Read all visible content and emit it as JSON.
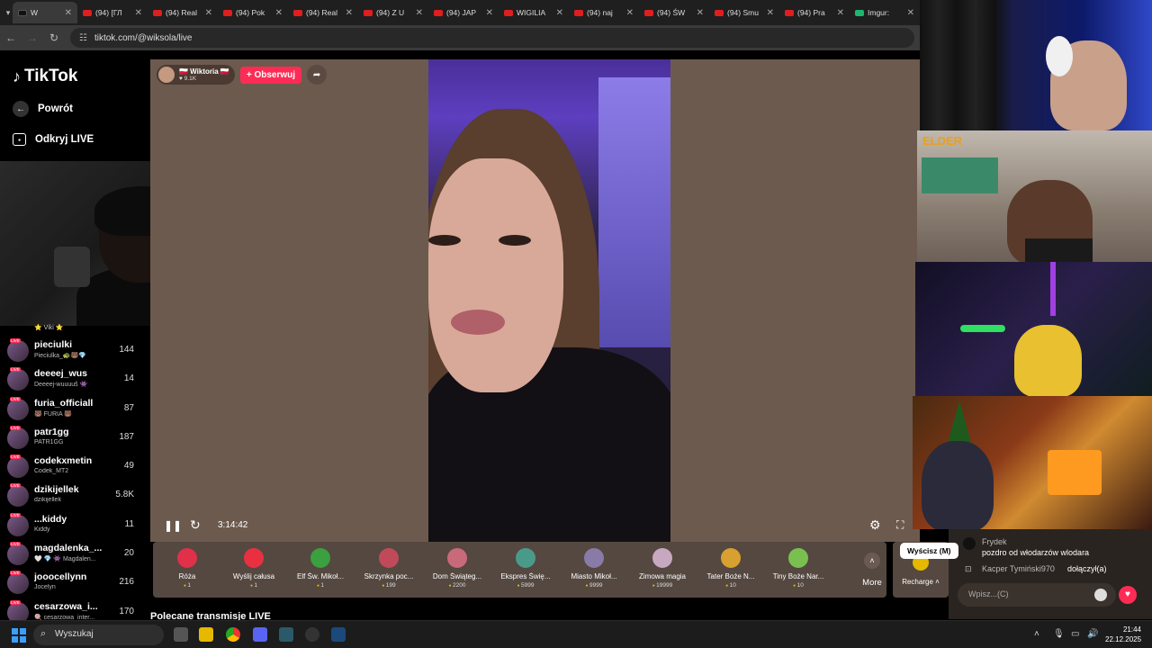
{
  "browser": {
    "url": "tiktok.com/@wiksola/live",
    "tabs": [
      {
        "title": "W",
        "type": "tiktok",
        "active": true
      },
      {
        "title": "(94) [ГЛ",
        "type": "yt"
      },
      {
        "title": "(94) Real",
        "type": "yt"
      },
      {
        "title": "(94) Pok",
        "type": "yt"
      },
      {
        "title": "(94) Real",
        "type": "yt"
      },
      {
        "title": "(94) Z U",
        "type": "yt"
      },
      {
        "title": "(94) JAP",
        "type": "yt"
      },
      {
        "title": "WIGILIA",
        "type": "yt"
      },
      {
        "title": "(94) naj",
        "type": "yt"
      },
      {
        "title": "(94) ŚW",
        "type": "yt"
      },
      {
        "title": "(94) Smu",
        "type": "yt"
      },
      {
        "title": "(94) Pra",
        "type": "yt"
      },
      {
        "title": "Imgur:",
        "type": "im"
      }
    ]
  },
  "sidebar": {
    "logo": "TikTok",
    "nav": [
      {
        "label": "Powrót",
        "icon": "back-arrow-icon"
      },
      {
        "label": "Odkryj LIVE",
        "icon": "live-tv-icon"
      }
    ],
    "partial_sub": "⭐ Viki ⭐",
    "accounts": [
      {
        "name": "pieciulki",
        "sub": "Pieciulka_🐢🐻💎",
        "count": "144"
      },
      {
        "name": "deeeej_wus",
        "sub": "Deeeej-wuuuuš 👾",
        "count": "14"
      },
      {
        "name": "furia_officiall",
        "sub": "🐻 FURIA 🐻",
        "count": "87"
      },
      {
        "name": "patr1gg",
        "sub": "PATR1GG",
        "count": "187"
      },
      {
        "name": "codekxmetin",
        "sub": "Codek_MT2",
        "count": "49"
      },
      {
        "name": "dzikijellek",
        "sub": "dzikijellek",
        "count": "5.8K"
      },
      {
        "name": "...kiddy",
        "sub": "Kiddy",
        "count": "11"
      },
      {
        "name": "magdalenka_...",
        "sub": "🤍 💎 👾 Magdalen...",
        "count": "20"
      },
      {
        "name": "jooocellynn",
        "sub": "Jocelyn",
        "count": "216"
      },
      {
        "name": "cesarzowa_i...",
        "sub": "🍭 cesarzowa_inter...",
        "count": "170"
      }
    ]
  },
  "stream": {
    "host_name": "🇵🇱 Wiktoria 🇵🇱",
    "host_likes": "♥ 9.1K",
    "follow_label": "+ Obserwuj",
    "timer": "3:14:42",
    "mute_tooltip": "Wyścisz (M)"
  },
  "gifts": [
    {
      "name": "Róża",
      "price": "1",
      "color": "#e0304a"
    },
    {
      "name": "Wyślij całusa",
      "price": "1",
      "color": "#e83040"
    },
    {
      "name": "Elf Św. Mikoł...",
      "price": "1",
      "color": "#3aa040"
    },
    {
      "name": "Skrzynka poc...",
      "price": "199",
      "color": "#c04a5a"
    },
    {
      "name": "Dom Świąteg...",
      "price": "2200",
      "color": "#c86a7a"
    },
    {
      "name": "Ekspres Świę...",
      "price": "5999",
      "color": "#4a9a8a"
    },
    {
      "name": "Miasto Mikoł...",
      "price": "9999",
      "color": "#8a7aa8"
    },
    {
      "name": "Zimowa magia",
      "price": "19999",
      "color": "#c8a8c0"
    },
    {
      "name": "Tater Boże N...",
      "price": "10",
      "color": "#d8a030"
    },
    {
      "name": "Tiny Boże Nar...",
      "price": "10",
      "color": "#7ac050"
    }
  ],
  "more_label": "More",
  "recharge_label": "Recharge",
  "recommended_heading": "Polecane transmisje LIVE",
  "chat": {
    "messages": [
      {
        "user": "Frydek",
        "text": "pozdro od włodarzów wlodara"
      },
      {
        "user": "Kacper Tymiński970",
        "text": "dołączył(a)"
      }
    ],
    "input_placeholder": "Wpisz...(C)"
  },
  "overlay_logo": "ELDER",
  "taskbar": {
    "search_placeholder": "Wyszukaj",
    "time": "21:44",
    "date": "22.12.2025"
  }
}
